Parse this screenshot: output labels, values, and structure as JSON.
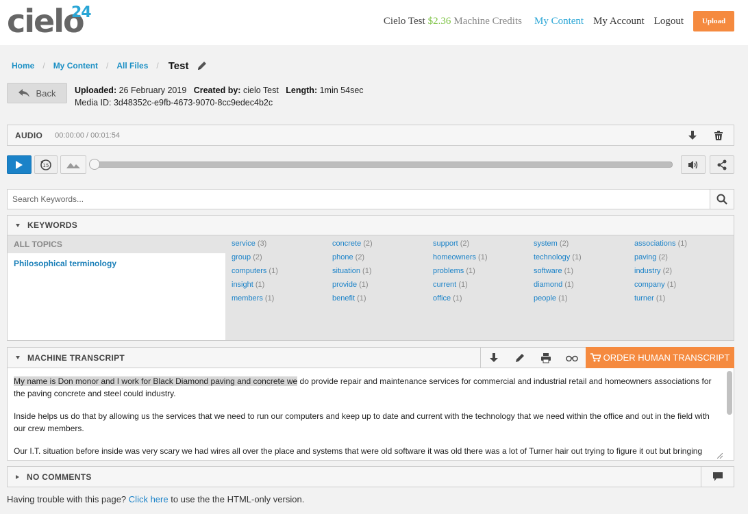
{
  "header": {
    "logo_word": "cielo",
    "logo_number": "24",
    "user_name": "Cielo Test",
    "credits_amount": "$2.36",
    "credits_label": "Machine Credits",
    "nav": [
      "My Content",
      "My Account",
      "Logout"
    ],
    "upload_label": "Upload",
    "accent_color": "#2aa6d6",
    "upload_color": "#f58a3f"
  },
  "breadcrumb": {
    "items": [
      "Home",
      "My Content",
      "All Files"
    ],
    "current": "Test"
  },
  "back_label": "Back",
  "meta": {
    "uploaded_label": "Uploaded:",
    "uploaded_value": "26 February 2019",
    "created_label": "Created by:",
    "created_value": "cielo Test",
    "length_label": "Length:",
    "length_value": "1min 54sec",
    "media_id_label": "Media ID:",
    "media_id_value": "3d48352c-e9fb-4673-9070-8cc9edec4b2c"
  },
  "audio": {
    "title": "AUDIO",
    "time": "00:00:00 / 00:01:54",
    "progress": 0
  },
  "search": {
    "placeholder": "Search Keywords..."
  },
  "keywords": {
    "title": "KEYWORDS",
    "topics_header": "ALL TOPICS",
    "topics": [
      "Philosophical terminology"
    ],
    "columns": [
      [
        {
          "word": "service",
          "count": "(3)"
        },
        {
          "word": "group",
          "count": "(2)"
        },
        {
          "word": "computers",
          "count": "(1)"
        },
        {
          "word": "insight",
          "count": "(1)"
        },
        {
          "word": "members",
          "count": "(1)"
        }
      ],
      [
        {
          "word": "concrete",
          "count": "(2)"
        },
        {
          "word": "phone",
          "count": "(2)"
        },
        {
          "word": "situation",
          "count": "(1)"
        },
        {
          "word": "provide",
          "count": "(1)"
        },
        {
          "word": "benefit",
          "count": "(1)"
        }
      ],
      [
        {
          "word": "support",
          "count": "(2)"
        },
        {
          "word": "homeowners",
          "count": "(1)"
        },
        {
          "word": "problems",
          "count": "(1)"
        },
        {
          "word": "current",
          "count": "(1)"
        },
        {
          "word": "office",
          "count": "(1)"
        }
      ],
      [
        {
          "word": "system",
          "count": "(2)"
        },
        {
          "word": "technology",
          "count": "(1)"
        },
        {
          "word": "software",
          "count": "(1)"
        },
        {
          "word": "diamond",
          "count": "(1)"
        },
        {
          "word": "people",
          "count": "(1)"
        }
      ],
      [
        {
          "word": "associations",
          "count": "(1)"
        },
        {
          "word": "paving",
          "count": "(2)"
        },
        {
          "word": "industry",
          "count": "(2)"
        },
        {
          "word": "company",
          "count": "(1)"
        },
        {
          "word": "turner",
          "count": "(1)"
        }
      ]
    ]
  },
  "transcript": {
    "title": "MACHINE TRANSCRIPT",
    "order_label": "ORDER HUMAN TRANSCRIPT",
    "p1_highlight": "My name is Don monor and I work for Black Diamond paving and concrete we",
    "p1_rest": " do provide repair and maintenance services for commercial and industrial retail and homeowners associations for the paving concrete and steel could industry.",
    "p2": "Inside helps us do that by allowing us the services that we need to run our computers and keep up to date and current with the technology that we need within the office and out in the field with our crew members.",
    "p3": "Our I.T. situation before inside was very scary we had wires all over the place and systems that were old software it was old there was a lot of Turner hair out trying to figure it out but bringing insight on was a lifesaver."
  },
  "comments": {
    "title": "NO COMMENTS"
  },
  "footer": {
    "prefix": "Having trouble with this page?",
    "link": "Click here",
    "suffix": "to use the the HTML-only version."
  }
}
